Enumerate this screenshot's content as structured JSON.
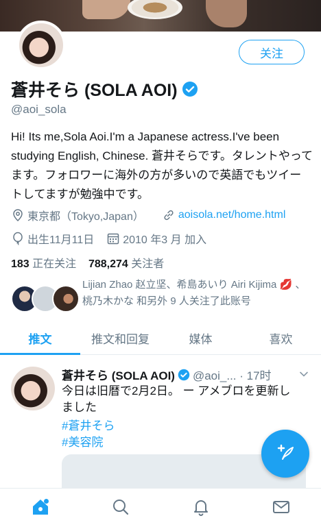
{
  "profile": {
    "display_name": "蒼井そら (SOLA AOI)",
    "handle": "@aoi_sola",
    "follow_label": "关注",
    "bio": "Hi! Its me,Sola Aoi.I'm a Japanese actress.I've been studying English, Chinese. 蒼井そらです。タレントやってます。フォロワーに海外の方が多いので英語でもツイートしてますが勉強中です。",
    "location": "東京都（Tokyo,Japan）",
    "website": "aoisola.net/home.html",
    "birthday": "出生11月11日",
    "joined": "2010 年3 月 加入",
    "following_count": "183",
    "following_label": "正在关注",
    "followers_count": "788,274",
    "followers_label": "关注者",
    "followed_by_text": "Lijian Zhao 赵立坚、希島あいり Airi Kijima 💋 、桃乃木かな 和另外 9 人关注了此账号"
  },
  "tabs": [
    {
      "label": "推文"
    },
    {
      "label": "推文和回复"
    },
    {
      "label": "媒体"
    },
    {
      "label": "喜欢"
    }
  ],
  "tweet": {
    "author": "蒼井そら (SOLA AOI)",
    "handle_time": "@aoi_... · 17时",
    "text": "今日は旧暦で2月2日。 ー アメブロを更新しました",
    "hashtags": [
      "#蒼井そら",
      "#美容院"
    ]
  },
  "nav": {
    "items": [
      "home-icon",
      "search-icon",
      "bell-icon",
      "mail-icon"
    ]
  },
  "colors": {
    "accent": "#1da1f2",
    "text": "#14171a",
    "secondary": "#657786"
  }
}
